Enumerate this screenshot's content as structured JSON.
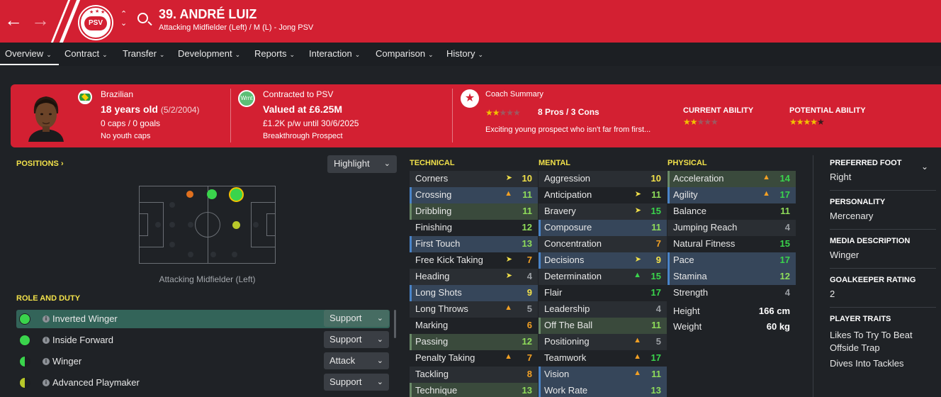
{
  "header": {
    "title": "39. ANDRÉ LUIZ",
    "subtitle": "Attacking Midfielder (Left) / M (L) - Jong PSV",
    "club_badge_text": "PSV"
  },
  "tabs": [
    {
      "label": "Overview"
    },
    {
      "label": "Contract"
    },
    {
      "label": "Transfer"
    },
    {
      "label": "Development"
    },
    {
      "label": "Reports"
    },
    {
      "label": "Interaction"
    },
    {
      "label": "Comparison"
    },
    {
      "label": "History"
    }
  ],
  "summary": {
    "nationality": "Brazilian",
    "age": "18 years old",
    "dob": "(5/2/2004)",
    "caps": "0 caps / 0 goals",
    "youth_caps": "No youth caps",
    "contract_badge": "Wrnt",
    "contract_line": "Contracted to PSV",
    "value": "Valued at £6.25M",
    "wage": "£1.2K p/w until 30/6/2025",
    "prospect": "Breakthrough Prospect",
    "coach_summary_label": "Coach Summary",
    "pros_cons": "8 Pros / 3 Cons",
    "coach_text": "Exciting young prospect who isn't far from first...",
    "current_ability_label": "CURRENT ABILITY",
    "potential_ability_label": "POTENTIAL ABILITY",
    "coach_stars": 2,
    "current_ability_stars": 2,
    "potential_ability_stars": 4
  },
  "positions": {
    "title": "POSITIONS",
    "highlight_label": "Highlight",
    "caption": "Attacking Midfielder (Left)"
  },
  "role_duty": {
    "title": "ROLE AND DUTY",
    "roles": [
      {
        "name": "Inverted Winger",
        "duty": "Support"
      },
      {
        "name": "Inside Forward",
        "duty": "Support"
      },
      {
        "name": "Winger",
        "duty": "Attack"
      },
      {
        "name": "Advanced Playmaker",
        "duty": "Support"
      }
    ]
  },
  "technical": {
    "title": "TECHNICAL",
    "attrs": [
      {
        "name": "Corners",
        "value": "10"
      },
      {
        "name": "Crossing",
        "value": "11"
      },
      {
        "name": "Dribbling",
        "value": "11"
      },
      {
        "name": "Finishing",
        "value": "12"
      },
      {
        "name": "First Touch",
        "value": "13"
      },
      {
        "name": "Free Kick Taking",
        "value": "7"
      },
      {
        "name": "Heading",
        "value": "4"
      },
      {
        "name": "Long Shots",
        "value": "9"
      },
      {
        "name": "Long Throws",
        "value": "5"
      },
      {
        "name": "Marking",
        "value": "6"
      },
      {
        "name": "Passing",
        "value": "12"
      },
      {
        "name": "Penalty Taking",
        "value": "7"
      },
      {
        "name": "Tackling",
        "value": "8"
      },
      {
        "name": "Technique",
        "value": "13"
      }
    ]
  },
  "mental": {
    "title": "MENTAL",
    "attrs": [
      {
        "name": "Aggression",
        "value": "10"
      },
      {
        "name": "Anticipation",
        "value": "11"
      },
      {
        "name": "Bravery",
        "value": "15"
      },
      {
        "name": "Composure",
        "value": "11"
      },
      {
        "name": "Concentration",
        "value": "7"
      },
      {
        "name": "Decisions",
        "value": "9"
      },
      {
        "name": "Determination",
        "value": "15"
      },
      {
        "name": "Flair",
        "value": "17"
      },
      {
        "name": "Leadership",
        "value": "4"
      },
      {
        "name": "Off The Ball",
        "value": "11"
      },
      {
        "name": "Positioning",
        "value": "5"
      },
      {
        "name": "Teamwork",
        "value": "17"
      },
      {
        "name": "Vision",
        "value": "11"
      },
      {
        "name": "Work Rate",
        "value": "13"
      }
    ]
  },
  "physical": {
    "title": "PHYSICAL",
    "attrs": [
      {
        "name": "Acceleration",
        "value": "14"
      },
      {
        "name": "Agility",
        "value": "17"
      },
      {
        "name": "Balance",
        "value": "11"
      },
      {
        "name": "Jumping Reach",
        "value": "4"
      },
      {
        "name": "Natural Fitness",
        "value": "15"
      },
      {
        "name": "Pace",
        "value": "17"
      },
      {
        "name": "Stamina",
        "value": "12"
      },
      {
        "name": "Strength",
        "value": "4"
      }
    ],
    "height_label": "Height",
    "height_value": "166 cm",
    "weight_label": "Weight",
    "weight_value": "60 kg"
  },
  "info": {
    "preferred_foot_label": "PREFERRED FOOT",
    "preferred_foot": "Right",
    "personality_label": "PERSONALITY",
    "personality": "Mercenary",
    "media_label": "MEDIA DESCRIPTION",
    "media": "Winger",
    "gk_rating_label": "GOALKEEPER RATING",
    "gk_rating": "2",
    "traits_label": "PLAYER TRAITS",
    "traits": [
      "Likes To Try To Beat",
      "Offside Trap",
      "Dives Into Tackles"
    ]
  },
  "colors": {
    "brand_red": "#d32032",
    "accent_yellow": "#f2e14a",
    "green": "#3ad44c",
    "background": "#1f2226"
  }
}
